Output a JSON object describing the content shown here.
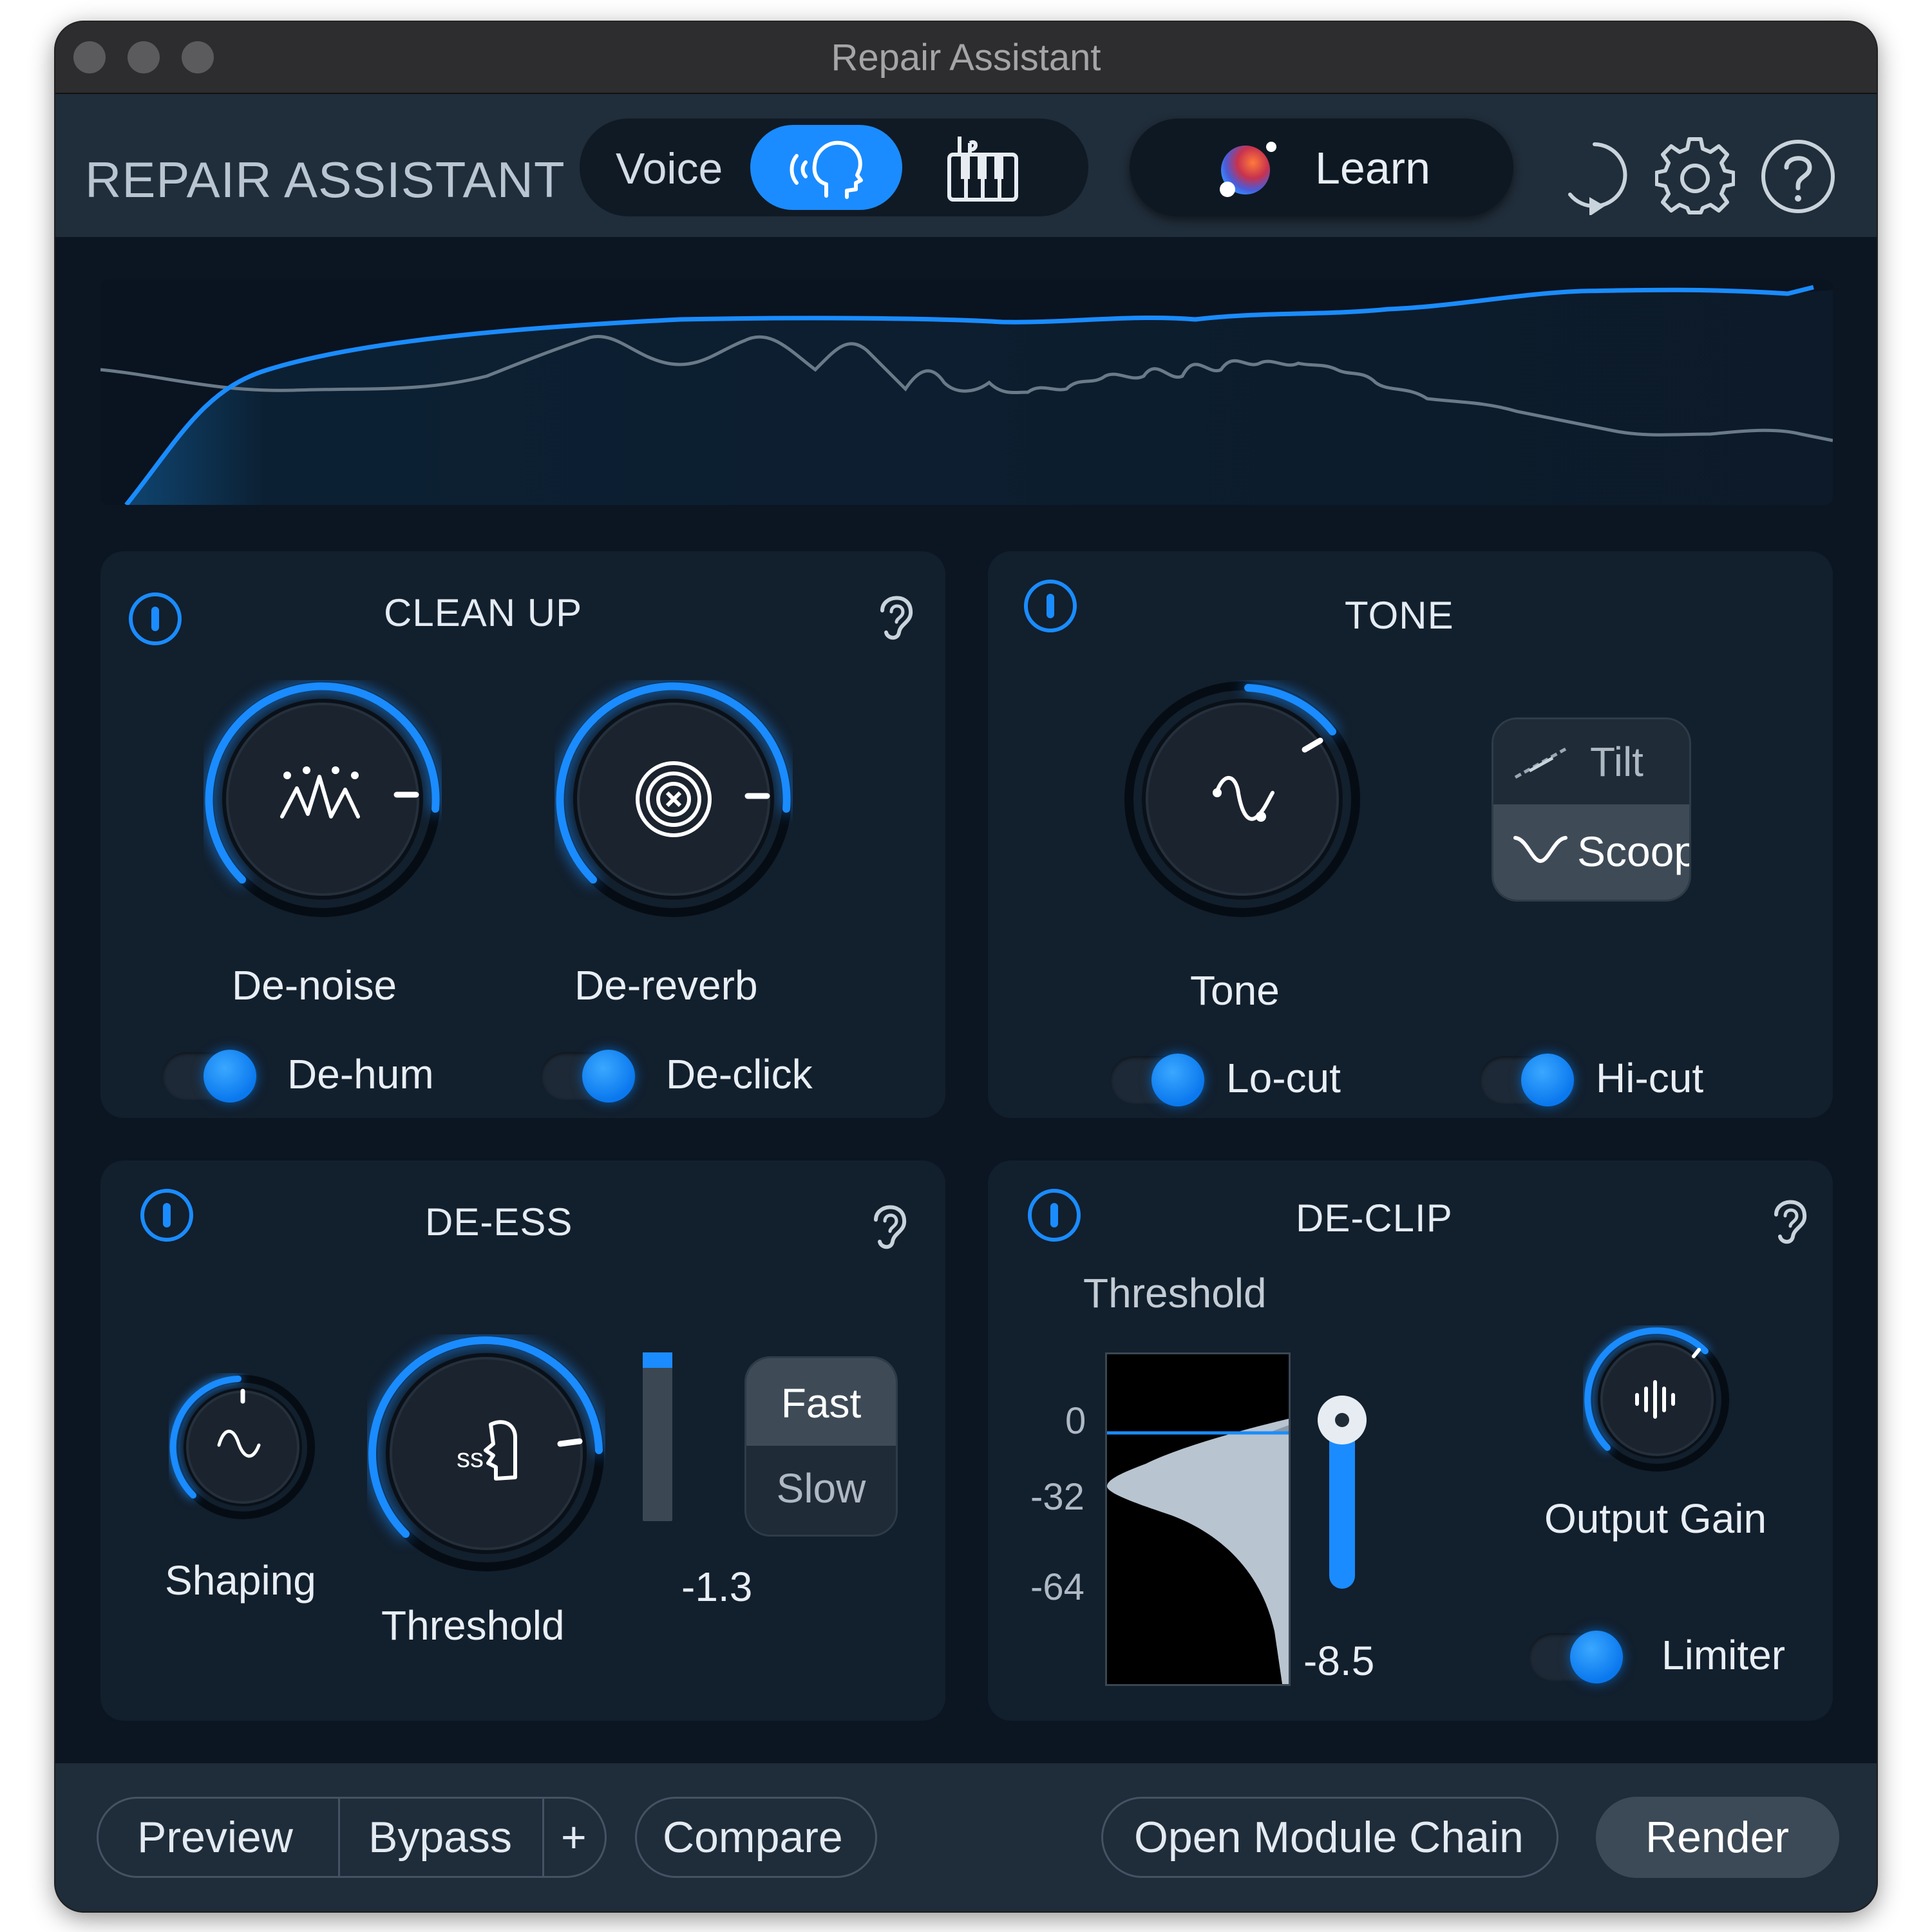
{
  "window": {
    "title": "Repair Assistant"
  },
  "header": {
    "brand": "REPAIR ASSISTANT",
    "mode_label": "Voice",
    "learn_label": "Learn"
  },
  "clean_up": {
    "title": "CLEAN UP",
    "denoise_label": "De-noise",
    "dereverb_label": "De-reverb",
    "dehum_label": "De-hum",
    "declick_label": "De-click"
  },
  "tone": {
    "title": "TONE",
    "tone_label": "Tone",
    "tilt_label": "Tilt",
    "scoop_label": "Scoop",
    "locut_label": "Lo-cut",
    "hicut_label": "Hi-cut"
  },
  "de_ess": {
    "title": "DE-ESS",
    "shaping_label": "Shaping",
    "threshold_label": "Threshold",
    "meter_value": "-1.3",
    "fast_label": "Fast",
    "slow_label": "Slow"
  },
  "de_clip": {
    "title": "DE-CLIP",
    "threshold_label": "Threshold",
    "scale": [
      "0",
      "-32",
      "-64"
    ],
    "threshold_value": "-8.5",
    "output_gain_label": "Output Gain",
    "limiter_label": "Limiter"
  },
  "footer": {
    "preview": "Preview",
    "bypass": "Bypass",
    "plus": "+",
    "compare": "Compare",
    "open_chain": "Open Module Chain",
    "render": "Render"
  },
  "colors": {
    "accent": "#1a8cff",
    "panel": "#121f2d",
    "background": "#0c1622"
  }
}
